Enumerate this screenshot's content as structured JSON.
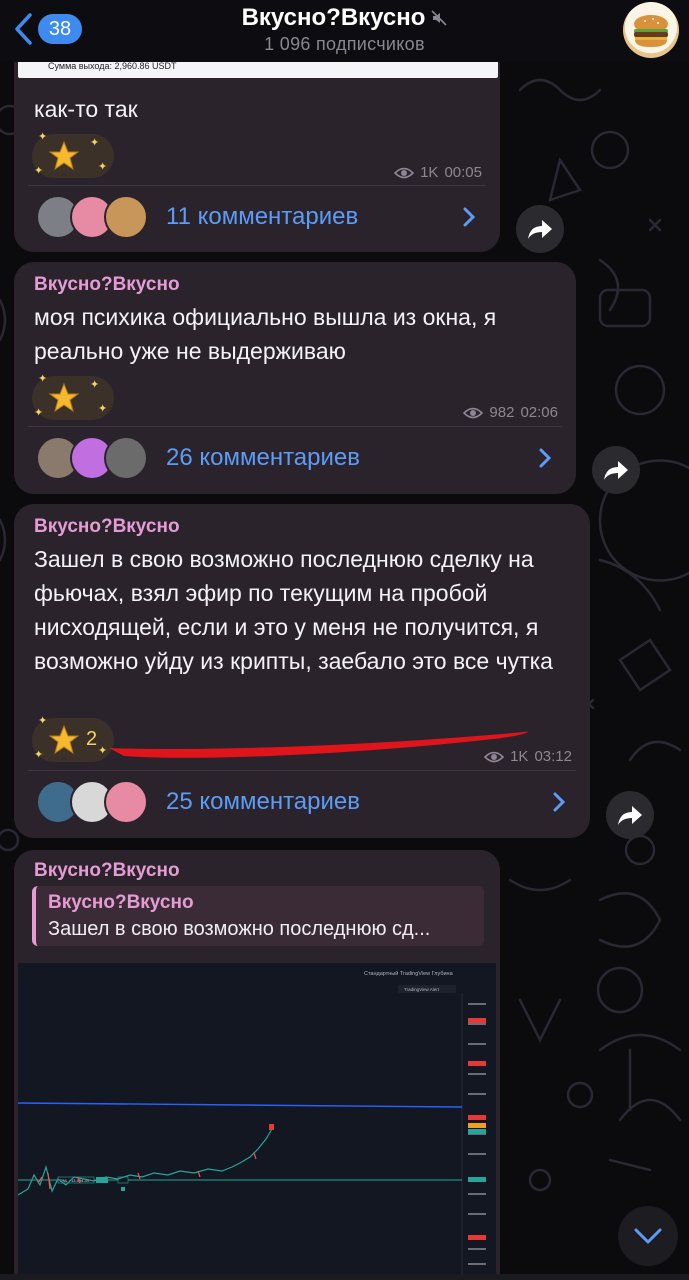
{
  "header": {
    "back_count": "38",
    "title": "Вкусно?Вкусно",
    "subscribers": "1 096 подписчиков"
  },
  "messages": [
    {
      "partial_top_text": "Сумма выхода: 2,960.86 USDT",
      "text": "как-то так",
      "views": "1K",
      "time": "00:05",
      "comments": "11 комментариев"
    },
    {
      "sender": "Вкусно?Вкусно",
      "text": "моя психика официально вышла из окна, я реально уже не выдерживаю",
      "views": "982",
      "time": "02:06",
      "comments": "26 комментариев"
    },
    {
      "sender": "Вкусно?Вкусно",
      "text": "Зашел в свою возможно последнюю сделку на фьючах, взял эфир по текущим на пробой нисходящей, если и это у меня не получится, я возможно уйду из крипты, заебало это все чутка",
      "reaction_count": "2",
      "views": "1K",
      "time": "03:12",
      "comments": "25 комментариев"
    },
    {
      "sender": "Вкусно?Вкусно",
      "reply_name": "Вкусно?Вкусно",
      "reply_text": "Зашел в свою возможно последнюю сд...",
      "chart_toolbar": "Стандартный  TradingView  Глубина",
      "chart_alert": "TradingView Alert",
      "pnl_label": "PNL +13,984.34"
    }
  ],
  "colors": {
    "accent": "#5d9cf5",
    "sender": "#e59bd3",
    "badge": "#3e8bf0",
    "bubble": "#2a232c"
  }
}
